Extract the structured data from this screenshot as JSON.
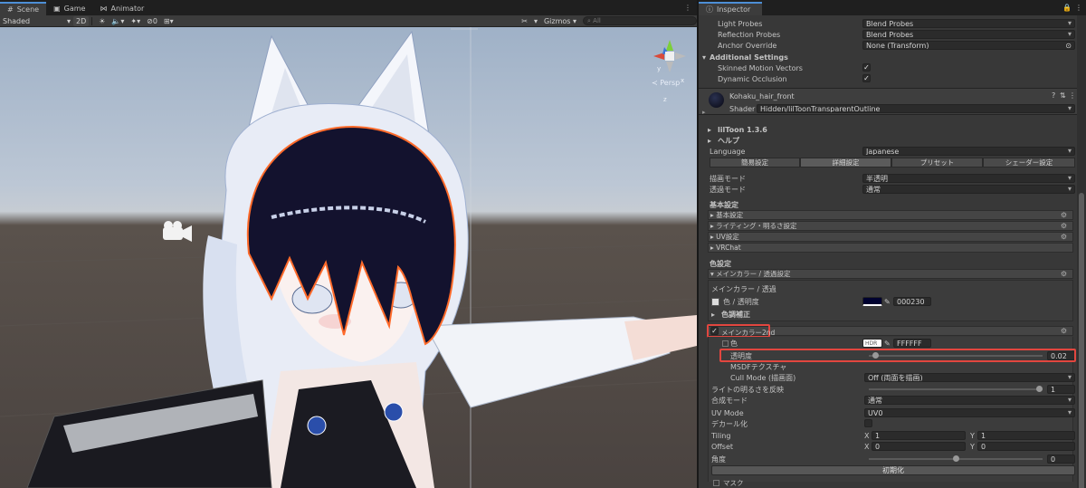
{
  "scene": {
    "tabs": [
      {
        "label": "Scene",
        "icon": "hash-icon"
      },
      {
        "label": "Game",
        "icon": "gamepad-icon"
      },
      {
        "label": "Animator",
        "icon": "animator-icon"
      }
    ],
    "menu_glyph": "⋮",
    "shading_mode": "Shaded",
    "mode_2d": "2D",
    "hidden_count": "0",
    "gizmos_label": "Gizmos",
    "search_placeholder": "All",
    "persp_label": "Persp",
    "gizmo_axes": {
      "y": "y",
      "x": "x",
      "z": "z"
    }
  },
  "inspector": {
    "tab_label": "Inspector",
    "lock_glyph": "🔒",
    "menu_glyph": "⋮",
    "renderer": {
      "light_probes": {
        "label": "Light Probes",
        "value": "Blend Probes"
      },
      "reflection_probes": {
        "label": "Reflection Probes",
        "value": "Blend Probes"
      },
      "anchor_override": {
        "label": "Anchor Override",
        "value": "None (Transform)"
      },
      "additional_settings": "Additional Settings",
      "skinned_motion_vectors": {
        "label": "Skinned Motion Vectors",
        "checked": true
      },
      "dynamic_occlusion": {
        "label": "Dynamic Occlusion",
        "checked": true
      }
    },
    "material": {
      "name": "Kohaku_hair_front",
      "shader_label": "Shader",
      "shader_value": "Hidden/lilToonTransparentOutline"
    },
    "liltoon": {
      "version": "lilToon 1.3.6",
      "help": "ヘルプ",
      "language_label": "Language",
      "language_value": "Japanese",
      "tabs": [
        "簡易設定",
        "詳細設定",
        "プリセット",
        "シェーダー設定"
      ],
      "active_tab": 1,
      "render_mode_label": "描画モード",
      "render_mode_value": "半透明",
      "transparency_mode_label": "透過モード",
      "transparency_mode_value": "通常",
      "basic_settings": "基本設定",
      "basic_sections": [
        "基本設定",
        "ライティング・明るさ設定",
        "UV設定",
        "VRChat"
      ],
      "color_settings": "色設定",
      "main_color_section": "メインカラー / 透過設定",
      "main_color_sub": "メインカラー / 透過",
      "color_alpha_label": "色 / 透明度",
      "color_alpha_hex": "000230",
      "color_correction": "色調補正",
      "main_color_2nd": "メインカラー2nd",
      "color2_label": "色",
      "color2_swatch_text": "HDR",
      "color2_hex": "FFFFFF",
      "opacity_label": "透明度",
      "opacity_value": "0.02",
      "opacity_fraction": 0.02,
      "msdf_label": "MSDFテクスチャ",
      "cull_mode_label": "Cull Mode (描画面)",
      "cull_mode_value": "Off (両面を描画)",
      "light_reflect_label": "ライトの明るさを反映",
      "light_reflect_value": "1",
      "light_reflect_fraction": 1,
      "blend_mode_label": "合成モード",
      "blend_mode_value": "通常",
      "uv_mode_label": "UV Mode",
      "uv_mode_value": "UV0",
      "decal_label": "デカール化",
      "tiling_label": "Tiling",
      "tiling_x": "1",
      "tiling_y": "1",
      "offset_label": "Offset",
      "offset_x": "0",
      "offset_y": "0",
      "axis_x": "X",
      "axis_y": "Y",
      "angle_label": "角度",
      "angle_value": "0",
      "angle_fraction": 0.5,
      "reset_button": "初期化",
      "mask_label": "マスク"
    },
    "colors": {
      "highlight": "#e2463f",
      "accent": "#4d8fd6"
    }
  }
}
